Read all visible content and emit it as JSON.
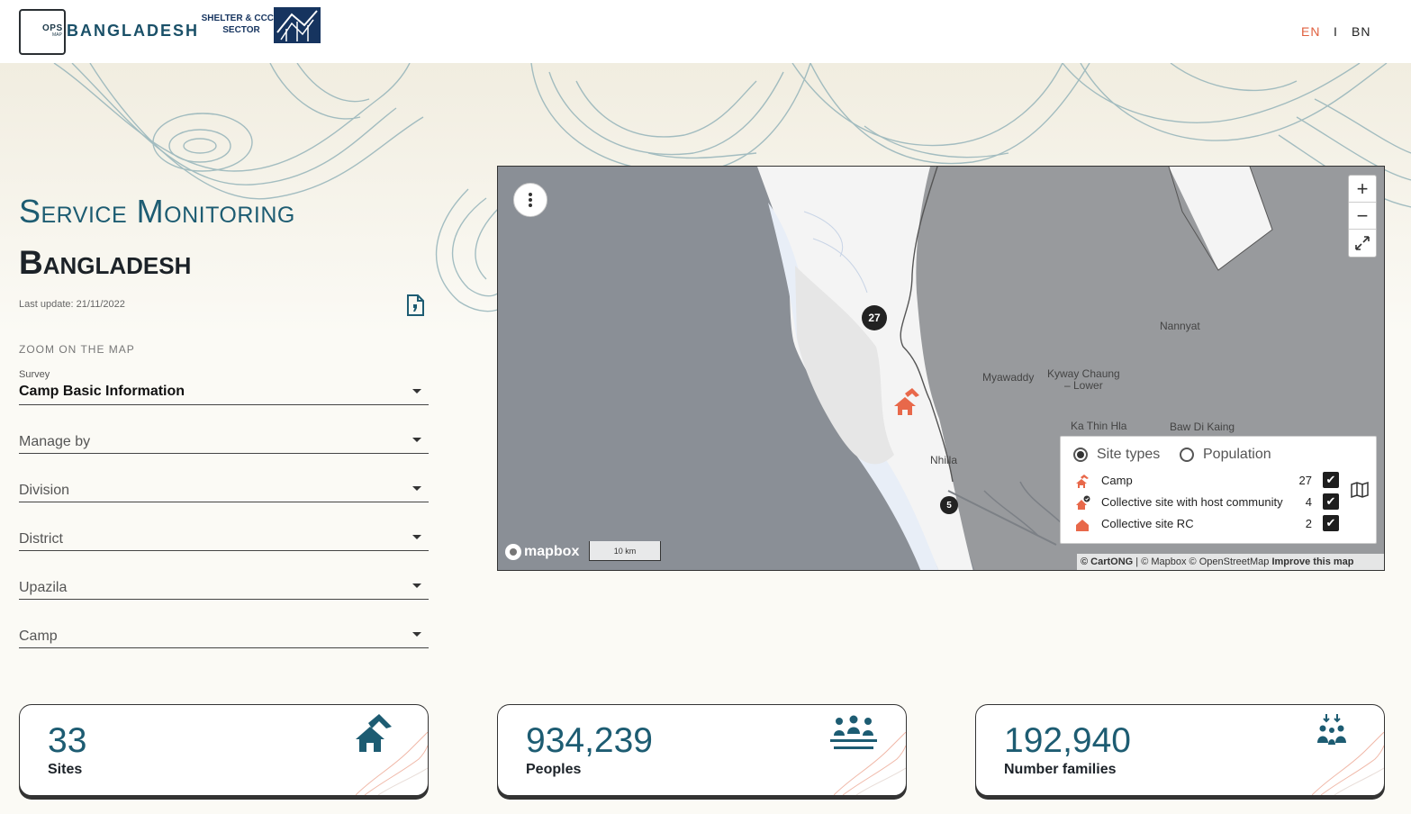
{
  "header": {
    "logo_ops": "OPS",
    "logo_map": "MAP",
    "logo_title": "BANGLADESH",
    "sector_line1": "SHELTER & CCCM",
    "sector_line2": "SECTOR",
    "lang_en": "EN",
    "lang_sep": "I",
    "lang_bn": "BN",
    "active_lang_color": "#e0603f"
  },
  "page": {
    "title": "Service Monitoring",
    "country": "Bangladesh",
    "last_update": "Last update: 21/11/2022",
    "zoom_label": "ZOOM ON THE MAP"
  },
  "filters": {
    "survey_label": "Survey",
    "survey_value": "Camp Basic Information",
    "manage_by": "Manage by",
    "division": "Division",
    "district": "District",
    "upazila": "Upazila",
    "camp": "Camp"
  },
  "map": {
    "zoom_in": "+",
    "zoom_out": "−",
    "clusters": [
      {
        "label": "27"
      },
      {
        "label": "5"
      }
    ],
    "places": {
      "nannyat": "Nannyat",
      "myawaddy": "Myawaddy",
      "kyway_chaung_1": "Kyway Chaung",
      "kyway_chaung_2": "– Lower",
      "ka_thin_hla": "Ka Thin Hla",
      "baw_di_kaing": "Baw Di Kaing",
      "nhilla": "Nhilla"
    },
    "mapbox_logo": "mapbox",
    "scale": "10 km",
    "attribution_prefix": "© CartONG",
    "attribution_rest": " | © Mapbox © OpenStreetMap ",
    "attribution_improve": "Improve this map",
    "legend": {
      "radio_site_types": "Site types",
      "radio_population": "Population",
      "selected": "Site types",
      "rows": [
        {
          "label": "Camp",
          "count": "27",
          "checked": true,
          "icon": "camp-icon"
        },
        {
          "label": "Collective site with host community",
          "count": "4",
          "checked": true,
          "icon": "host-community-icon"
        },
        {
          "label": "Collective site RC",
          "count": "2",
          "checked": true,
          "icon": "collective-site-icon"
        }
      ]
    },
    "marker_color": "#e8684a",
    "water_color": "#8a8f96"
  },
  "stats": [
    {
      "value": "33",
      "label": "Sites",
      "icon": "tent-icon"
    },
    {
      "value": "934,239",
      "label": "Peoples",
      "icon": "people-icon"
    },
    {
      "value": "192,940",
      "label": "Number families",
      "icon": "family-icon"
    }
  ],
  "colors": {
    "primary": "#1d5c72",
    "accent": "#e0603f",
    "background": "#fbfaf5"
  }
}
